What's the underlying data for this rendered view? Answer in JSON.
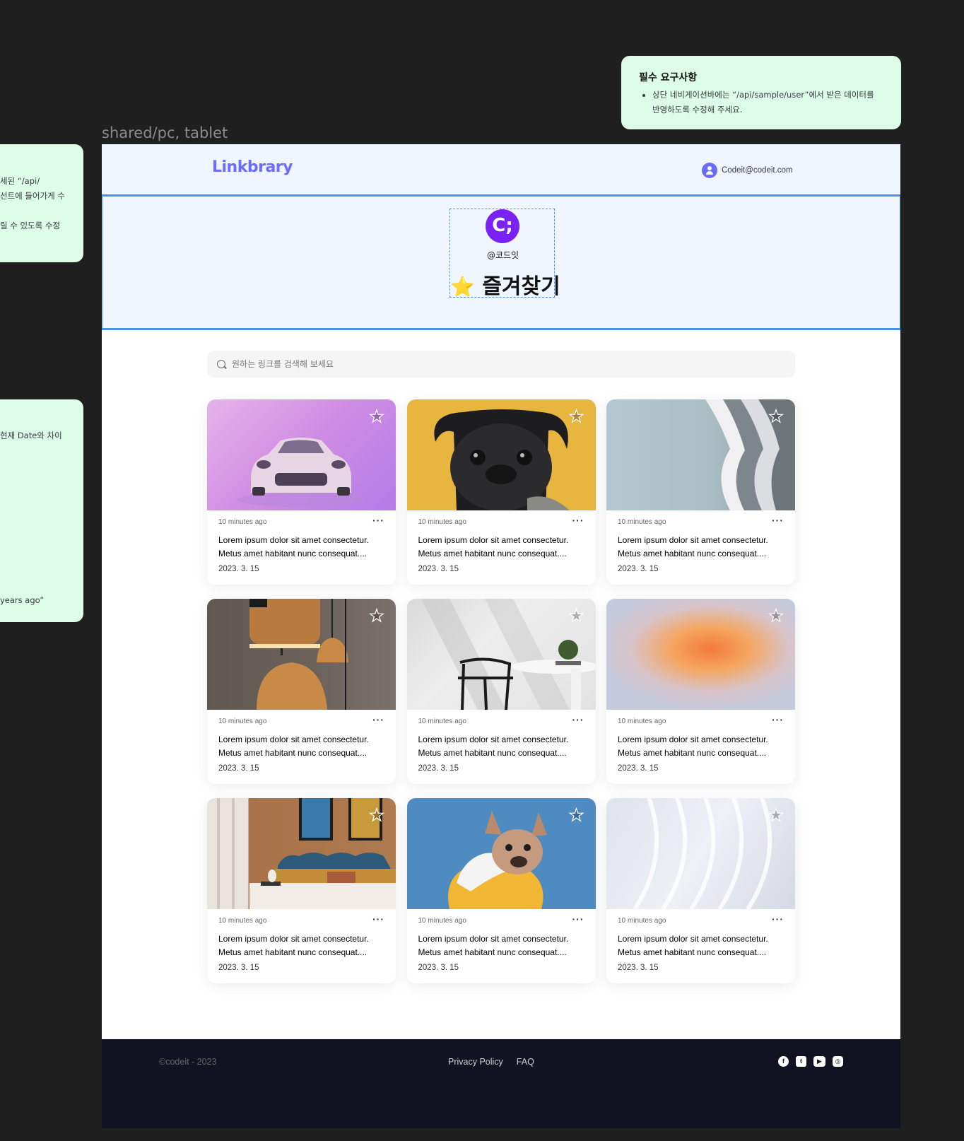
{
  "note_top": {
    "title": "필수 요구사항",
    "item1_line1": "상단 네비게이션바에는 “/api/sample/user”에서 받은 데이터를",
    "item1_line2": "반영하도록 수정해 주세요."
  },
  "note_left1": {
    "line1": "세된 “/api/",
    "line2": "선트에 들어가게 수",
    "line3": "릴 수 있도록 수정"
  },
  "note_left2": {
    "line1": "현재 Date와 차이",
    "line2": "years ago”"
  },
  "frame_label": "shared/pc, tablet",
  "nav": {
    "logo": "Linkbrary",
    "email": "Codeit@codeit.com"
  },
  "folder": {
    "avatar_text": "C;",
    "owner": "@코드잇",
    "star": "⭐",
    "name": "즐겨찾기"
  },
  "search": {
    "placeholder": "원하는 링크를 검색해 보세요"
  },
  "cards": [
    {
      "image": "pink sports car",
      "time": "10 minutes ago",
      "line1": "Lorem ipsum dolor sit amet consectetur.",
      "line2": "Metus amet habitant nunc consequat....",
      "date": "2023. 3. 15"
    },
    {
      "image": "black pug on yellow",
      "time": "10 minutes ago",
      "line1": "Lorem ipsum dolor sit amet consectetur.",
      "line2": "Metus amet habitant nunc consequat....",
      "date": "2023. 3. 15"
    },
    {
      "image": "curved white architecture",
      "time": "10 minutes ago",
      "line1": "Lorem ipsum dolor sit amet consectetur.",
      "line2": "Metus amet habitant nunc consequat....",
      "date": "2023. 3. 15"
    },
    {
      "image": "copper pendant lamps",
      "time": "10 minutes ago",
      "line1": "Lorem ipsum dolor sit amet consectetur.",
      "line2": "Metus amet habitant nunc consequat....",
      "date": "2023. 3. 15"
    },
    {
      "image": "black chair and white table",
      "time": "10 minutes ago",
      "line1": "Lorem ipsum dolor sit amet consectetur.",
      "line2": "Metus amet habitant nunc consequat....",
      "date": "2023. 3. 15"
    },
    {
      "image": "orange gradient blur",
      "time": "10 minutes ago",
      "line1": "Lorem ipsum dolor sit amet consectetur.",
      "line2": "Metus amet habitant nunc consequat....",
      "date": "2023. 3. 15"
    },
    {
      "image": "bedroom interior",
      "time": "10 minutes ago",
      "line1": "Lorem ipsum dolor sit amet consectetur.",
      "line2": "Metus amet habitant nunc consequat....",
      "date": "2023. 3. 15"
    },
    {
      "image": "french bulldog in yellow hoodie",
      "time": "10 minutes ago",
      "line1": "Lorem ipsum dolor sit amet consectetur.",
      "line2": "Metus amet habitant nunc consequat....",
      "date": "2023. 3. 15"
    },
    {
      "image": "white wavy abstract",
      "time": "10 minutes ago",
      "line1": "Lorem ipsum dolor sit amet consectetur.",
      "line2": "Metus amet habitant nunc consequat....",
      "date": "2023. 3. 15"
    }
  ],
  "card_icons": {
    "star": "star-outline-icon",
    "menu": "kebab-icon"
  },
  "footer": {
    "copyright": "©codeit - 2023",
    "privacy": "Privacy Policy",
    "faq": "FAQ",
    "socials": [
      "facebook-icon",
      "twitter-icon",
      "youtube-icon",
      "instagram-icon"
    ]
  },
  "colors": {
    "brand": "#6d6afe",
    "nav_bg": "#f0f6ff",
    "selection": "#4a8fe9",
    "note_bg": "#dcfce7",
    "footer_bg": "#111322"
  }
}
